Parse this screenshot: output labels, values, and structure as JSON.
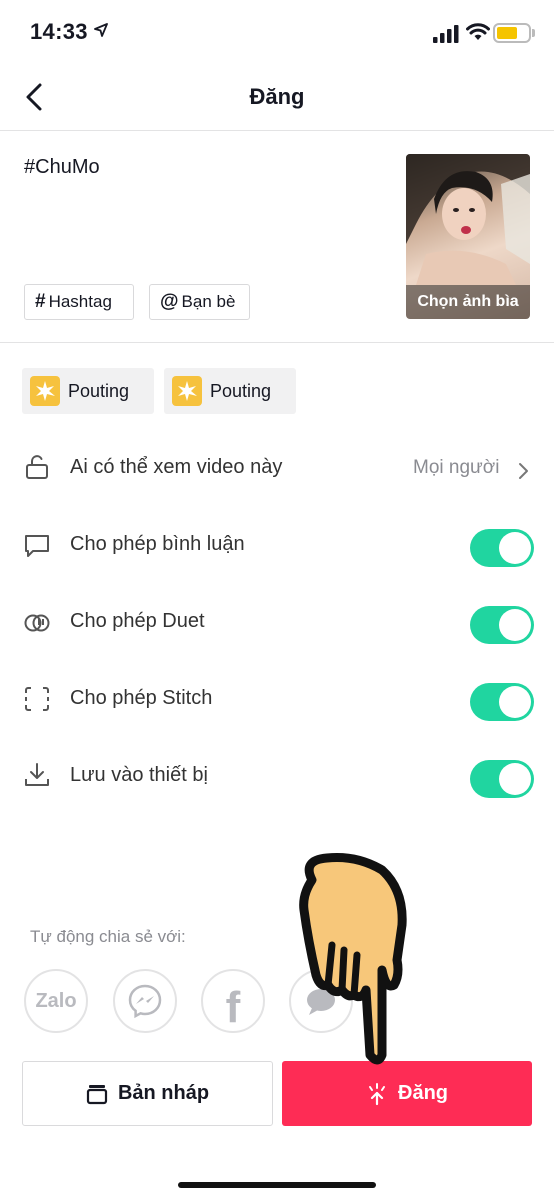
{
  "status_bar": {
    "time": "14:33"
  },
  "header": {
    "title": "Đăng"
  },
  "caption": "#ChuMo",
  "chips": {
    "hashtag": "Hashtag",
    "friends": "Bạn bè"
  },
  "cover": {
    "label": "Chọn ảnh bìa"
  },
  "effects": [
    {
      "label": "Pouting"
    },
    {
      "label": "Pouting"
    }
  ],
  "settings": {
    "viewer": {
      "label": "Ai có thể xem video này",
      "value": "Mọi người"
    },
    "comments": {
      "label": "Cho phép bình luận",
      "enabled": true
    },
    "duet": {
      "label": "Cho phép Duet",
      "enabled": true
    },
    "stitch": {
      "label": "Cho phép Stitch",
      "enabled": true
    },
    "save": {
      "label": "Lưu vào thiết bị",
      "enabled": true
    }
  },
  "share": {
    "label": "Tự động chia sẻ với:",
    "zalo_text": "Zalo",
    "facebook_text": "f"
  },
  "actions": {
    "draft": "Bản nháp",
    "post": "Đăng"
  },
  "colors": {
    "accent": "#fe2c55",
    "toggle_on": "#20d5a0",
    "battery": "#f5c400"
  }
}
